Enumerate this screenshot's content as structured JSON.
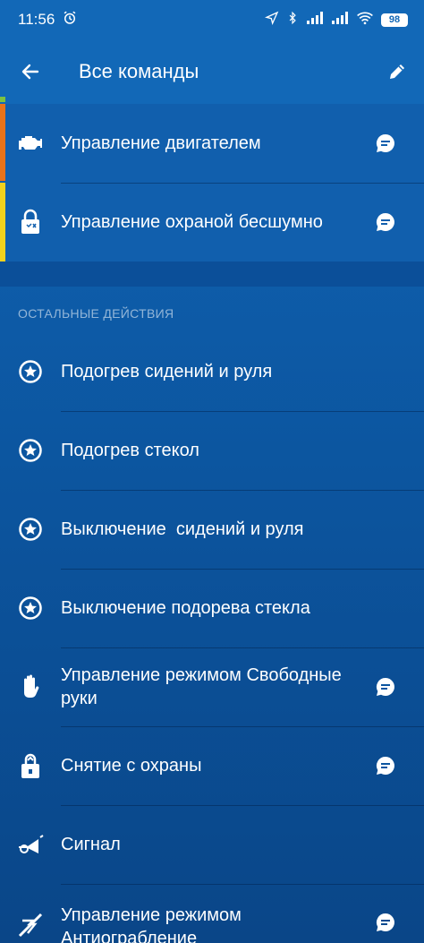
{
  "status": {
    "time": "11:56",
    "battery": "98"
  },
  "header": {
    "title": "Все команды"
  },
  "pinned": [
    {
      "label": "Управление двигателем",
      "icon": "engine-icon",
      "accent": "#e8731a"
    },
    {
      "label": "Управление охраной бесшумно",
      "icon": "silent-lock-icon",
      "accent": "#f2d21e"
    }
  ],
  "section": {
    "title": "ОСТАЛЬНЫЕ ДЕЙСТВИЯ"
  },
  "items": [
    {
      "label": "Подогрев сидений и руля",
      "icon": "star-circle-icon"
    },
    {
      "label": "Подогрев стекол",
      "icon": "star-circle-icon"
    },
    {
      "label": "Выключение  сидений и руля",
      "icon": "star-circle-icon"
    },
    {
      "label": "Выключение подорева стекла",
      "icon": "star-circle-icon"
    },
    {
      "label": "Управление режимом Свободные руки",
      "icon": "hand-icon"
    },
    {
      "label": "Снятие с охраны",
      "icon": "unlock-icon"
    },
    {
      "label": "Сигнал",
      "icon": "horn-icon"
    },
    {
      "label": "Управление режимом Антиограбление",
      "icon": "anti-robbery-icon"
    }
  ],
  "colors": {
    "app_bar": "#1268b7",
    "background": "#0d5aa6",
    "orange_accent": "#e8731a",
    "yellow_accent": "#f2d21e",
    "green_accent": "#7cc242"
  }
}
